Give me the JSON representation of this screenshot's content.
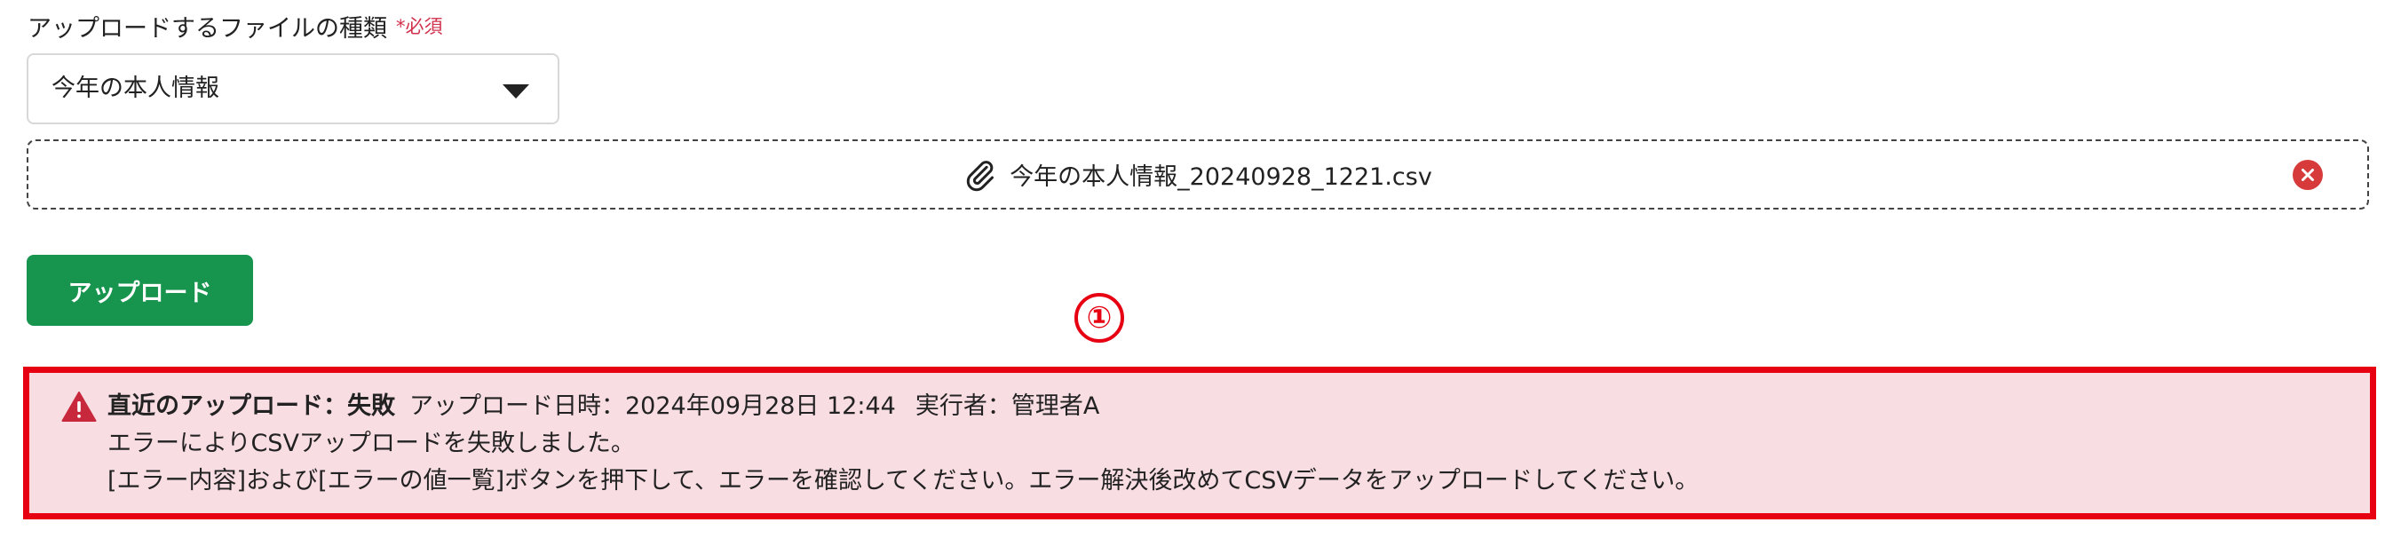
{
  "form": {
    "file_type_label": "アップロードするファイルの種類",
    "required_mark": "*必須",
    "file_type_selected": "今年の本人情報",
    "attached_file_name": "今年の本人情報_20240928_1221.csv",
    "upload_button_label": "アップロード"
  },
  "annotation": {
    "marker_text": "①",
    "color": "#e60012"
  },
  "last_upload": {
    "status_headline": "直近のアップロード：失敗",
    "datetime_text": "アップロード日時：2024年09月28日 12:44",
    "executor_text": "実行者：管理者A",
    "message_line1": "エラーによりCSVアップロードを失敗しました。",
    "message_line2": "[エラー内容]および[エラーの値一覧]ボタンを押下して、エラーを確認してください。エラー解決後改めてCSVデータをアップロードしてください。",
    "background_color": "#f8dde3",
    "icon_color": "#c8283c"
  },
  "colors": {
    "primary_button": "#17944d",
    "required": "#d0314c",
    "remove_icon": "#d63a3a"
  },
  "icons": {
    "select_caret": "caret-down-icon",
    "attachment": "paperclip-icon",
    "remove_file": "close-circle-icon",
    "error_status": "warning-triangle-icon"
  }
}
